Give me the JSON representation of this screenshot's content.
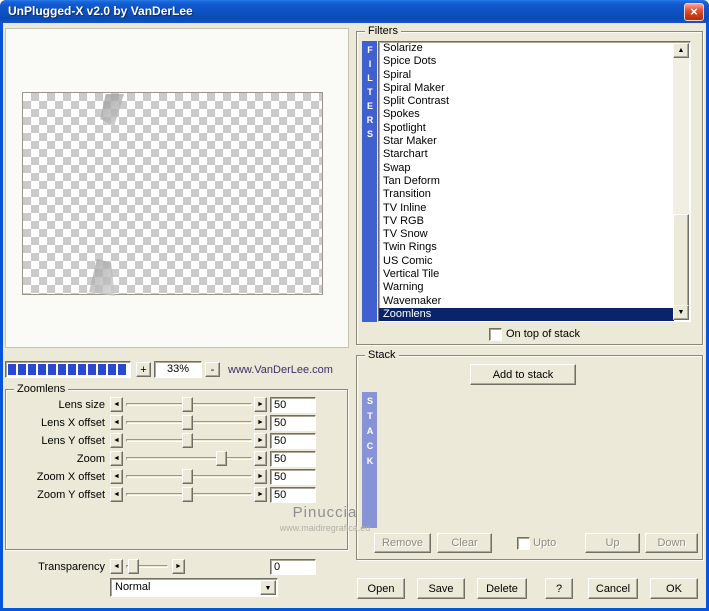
{
  "window": {
    "title": "UnPlugged-X v2.0 by VanDerLee"
  },
  "icons": {
    "close": "×",
    "arrow_left": "◄",
    "arrow_right": "►",
    "arrow_up": "▲",
    "arrow_down": "▼",
    "combo_down": "▼"
  },
  "colors": {
    "frame_blue": "#0855DD",
    "face": "#ECE9D8",
    "selection_navy": "#0A246A",
    "filters_bar_blue": "#4060D0",
    "stack_bar_blue": "#8793D6",
    "progress_blue": "#2B48D3",
    "link_navy": "#333366"
  },
  "preview": {
    "zoom_in": "+",
    "zoom_value": "33%",
    "zoom_out": "-",
    "website": "www.VanDerLee.com"
  },
  "zoomlens": {
    "title": "Zoomlens",
    "sliders": [
      {
        "label": "Lens size",
        "value": "50"
      },
      {
        "label": "Lens X offset",
        "value": "50"
      },
      {
        "label": "Lens Y offset",
        "value": "50"
      },
      {
        "label": "Zoom",
        "value": "50"
      },
      {
        "label": "Zoom X offset",
        "value": "50"
      },
      {
        "label": "Zoom Y offset",
        "value": "50"
      }
    ]
  },
  "transparency": {
    "label": "Transparency",
    "value": "0",
    "blend_mode": "Normal"
  },
  "filters": {
    "title": "Filters",
    "vertical_label": "FILTERS",
    "on_top_label": "On top of stack",
    "items": [
      "Solarize",
      "Spice Dots",
      "Spiral",
      "Spiral Maker",
      "Split Contrast",
      "Spokes",
      "Spotlight",
      "Star Maker",
      "Starchart",
      "Swap",
      "Tan Deform",
      "Transition",
      "TV Inline",
      "TV RGB",
      "TV Snow",
      "Twin Rings",
      "US Comic",
      "Vertical Tile",
      "Warning",
      "Wavemaker",
      "Zoomlens"
    ],
    "selected": "Zoomlens"
  },
  "stack": {
    "title": "Stack",
    "add_button": "Add to stack",
    "vertical_label": "STACK",
    "remove_button": "Remove",
    "clear_button": "Clear",
    "upto_label": "Upto",
    "up_button": "Up",
    "down_button": "Down"
  },
  "actions": {
    "open": "Open",
    "save": "Save",
    "delete": "Delete",
    "help": "?",
    "cancel": "Cancel",
    "ok": "OK"
  },
  "watermark": {
    "line1": "Pinuccia",
    "line2": "www.maidiregrafica.eu"
  }
}
